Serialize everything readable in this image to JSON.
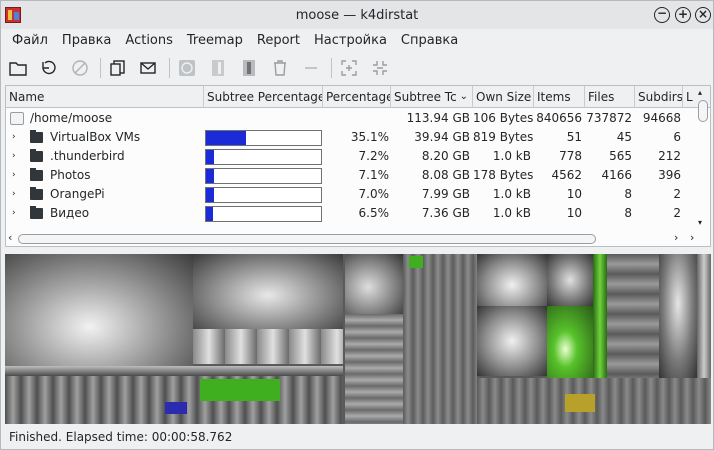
{
  "window": {
    "title": "moose — k4dirstat"
  },
  "colors": {
    "accent_bar": "#1b2bd8",
    "treemap_green": "#3fae1f"
  },
  "menu": [
    {
      "label": "Файл"
    },
    {
      "label": "Правка"
    },
    {
      "label": "Actions"
    },
    {
      "label": "Treemap"
    },
    {
      "label": "Report"
    },
    {
      "label": "Настройка"
    },
    {
      "label": "Справка"
    }
  ],
  "toolbar": {
    "icons": [
      "open-folder-icon",
      "refresh-icon",
      "stop-icon",
      "copy-icon",
      "mail-icon",
      "clean-icon",
      "zoom-out-tree-icon",
      "zoom-in-tree-icon",
      "delete-icon",
      "minus-icon",
      "treemap-zoom-in-icon",
      "treemap-zoom-out-icon"
    ]
  },
  "table": {
    "columns": [
      "Name",
      "Subtree Percentage",
      "Percentage",
      "Subtree Tc",
      "Own Size",
      "Items",
      "Files",
      "Subdirs",
      "L"
    ],
    "root": {
      "name": "/home/moose",
      "subtree": "113.94 GB",
      "own": "106 Bytes",
      "items": "840656",
      "files": "737872",
      "subdirs": "94668"
    },
    "rows": [
      {
        "name": "VirtualBox VMs",
        "fill": 0.351,
        "pct": "35.1%",
        "subtree": "39.94 GB",
        "own": "819 Bytes",
        "items": "51",
        "files": "45",
        "subdirs": "6"
      },
      {
        "name": ".thunderbird",
        "fill": 0.072,
        "pct": "7.2%",
        "subtree": "8.20 GB",
        "own": "1.0 kB",
        "items": "778",
        "files": "565",
        "subdirs": "212"
      },
      {
        "name": "Photos",
        "fill": 0.071,
        "pct": "7.1%",
        "subtree": "8.08 GB",
        "own": "178 Bytes",
        "items": "4562",
        "files": "4166",
        "subdirs": "396"
      },
      {
        "name": "OrangePi",
        "fill": 0.07,
        "pct": "7.0%",
        "subtree": "7.99 GB",
        "own": "1.0 kB",
        "items": "10",
        "files": "8",
        "subdirs": "2"
      },
      {
        "name": "Видео",
        "fill": 0.065,
        "pct": "6.5%",
        "subtree": "7.36 GB",
        "own": "1.0 kB",
        "items": "10",
        "files": "8",
        "subdirs": "2"
      }
    ]
  },
  "status": {
    "text": "Finished. Elapsed time: 00:00:58.762"
  }
}
